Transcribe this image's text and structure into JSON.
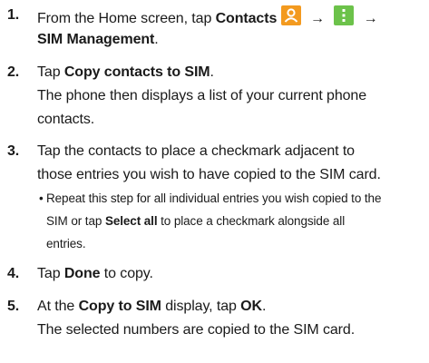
{
  "steps": [
    {
      "number": "1.",
      "pre": "From the Home screen, tap ",
      "bold1": "Contacts",
      "arrow": "→",
      "bold2": "SIM Management",
      "end": ".",
      "icons": [
        "contacts-app-icon",
        "menu-dots-icon"
      ]
    },
    {
      "number": "2.",
      "pre": "Tap ",
      "bold1": "Copy contacts to SIM",
      "end": ".",
      "result_line1": "The phone then displays a list of your current phone",
      "result_line2": "contacts."
    },
    {
      "number": "3.",
      "line1": "Tap the contacts to place a checkmark adjacent to",
      "line2": "those entries you wish to have copied to the SIM card.",
      "bullet": {
        "symbol": "•",
        "line1": "Repeat this step for all individual entries you wish copied to the",
        "line2_pre": "SIM or tap ",
        "line2_bold": "Select all",
        "line2_post": " to place a checkmark alongside all",
        "line3": "entries."
      }
    },
    {
      "number": "4.",
      "pre": "Tap ",
      "bold1": "Done",
      "post": " to copy."
    },
    {
      "number": "5.",
      "pre": "At the ",
      "bold1": "Copy to SIM",
      "mid": " display, tap ",
      "bold2": "OK",
      "end": ".",
      "result_line1": "The selected numbers are copied to the SIM card."
    }
  ],
  "colors": {
    "contacts_icon_bg": "#f39a1f",
    "menu_icon_bg": "#6cc24a",
    "text": "#1a1a1a"
  }
}
